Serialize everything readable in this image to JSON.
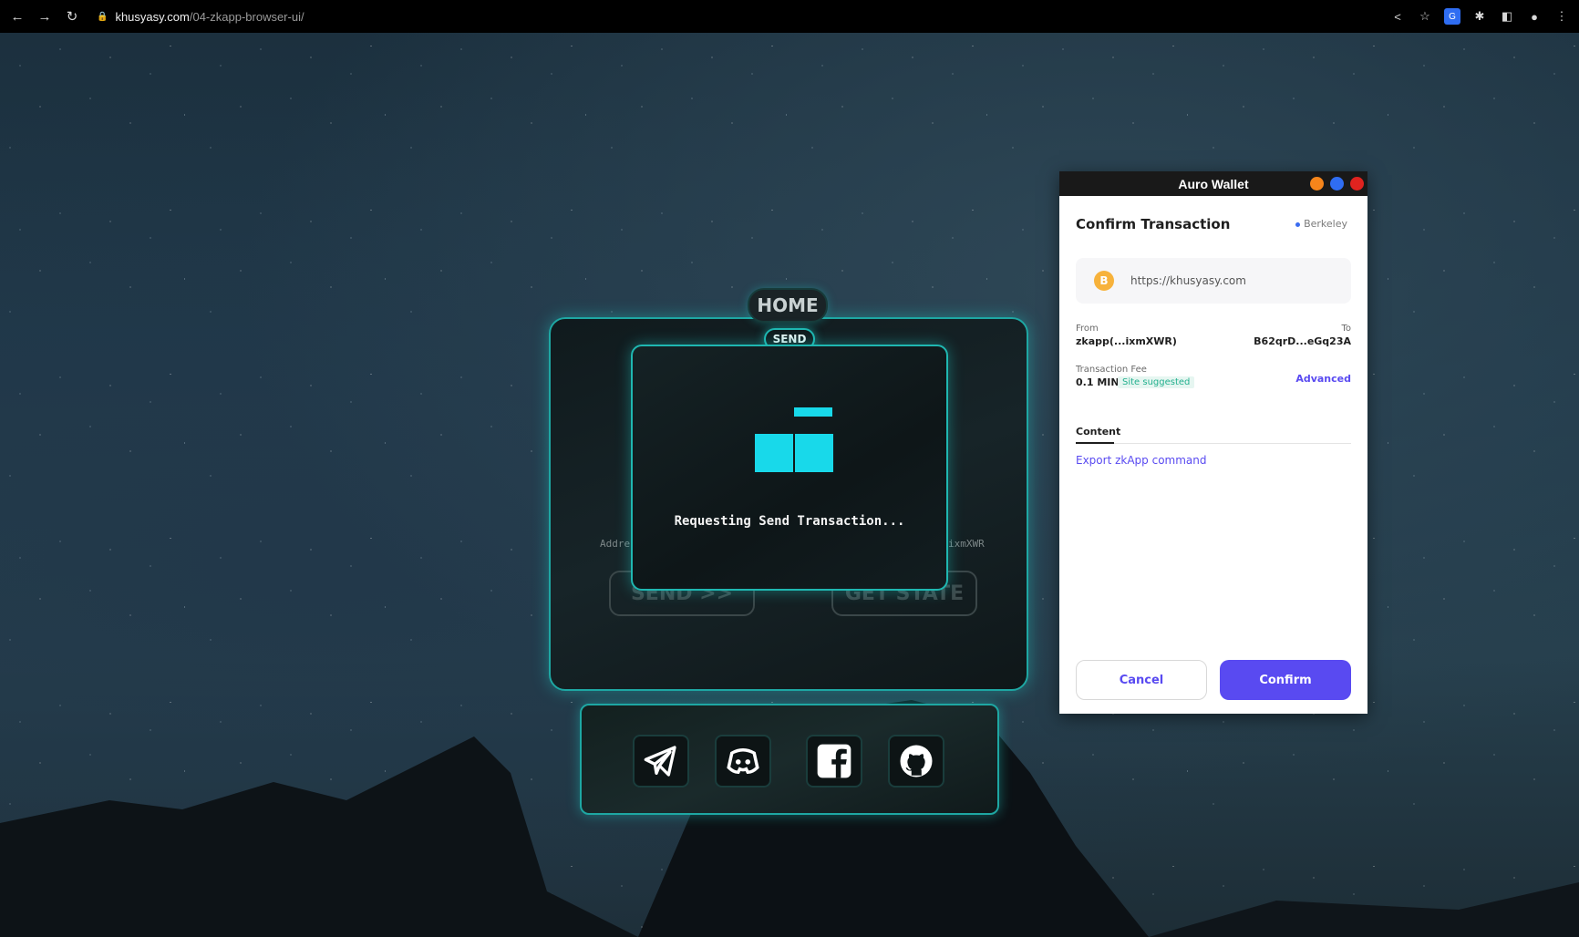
{
  "browser": {
    "url_host": "khusyasy.com",
    "url_path": "/04-zkapp-browser-ui/"
  },
  "app": {
    "home_tab": "HOME",
    "send_tab": "SEND",
    "address_label_partial": "Addre",
    "address_value_partial": "ixmXWR",
    "send_button": "SEND >>",
    "get_state_button": "GET STATE",
    "modal_text": "Requesting Send Transaction...",
    "accent_color": "#18d9ea",
    "social": [
      {
        "name": "telegram",
        "icon": "telegram-icon"
      },
      {
        "name": "discord",
        "icon": "discord-icon"
      },
      {
        "name": "facebook",
        "icon": "facebook-icon"
      },
      {
        "name": "github",
        "icon": "github-icon"
      }
    ]
  },
  "wallet": {
    "window_title": "Auro Wallet",
    "title": "Confirm Transaction",
    "network": "Berkeley",
    "site_url": "https://khusyasy.com",
    "site_icon_letter": "B",
    "from_label": "From",
    "from_value": "zkapp(...ixmXWR)",
    "to_label": "To",
    "to_value": "B62qrD...eGq23A",
    "fee_label": "Transaction Fee",
    "fee_value": "0.1 MINA",
    "fee_badge": "Site suggested",
    "advanced": "Advanced",
    "tab_content": "Content",
    "export_link": "Export zkApp command",
    "cancel": "Cancel",
    "confirm": "Confirm",
    "accent_color": "#594af1",
    "traffic_lights": [
      "#f6851b",
      "#2f6df2",
      "#e0231f"
    ]
  }
}
